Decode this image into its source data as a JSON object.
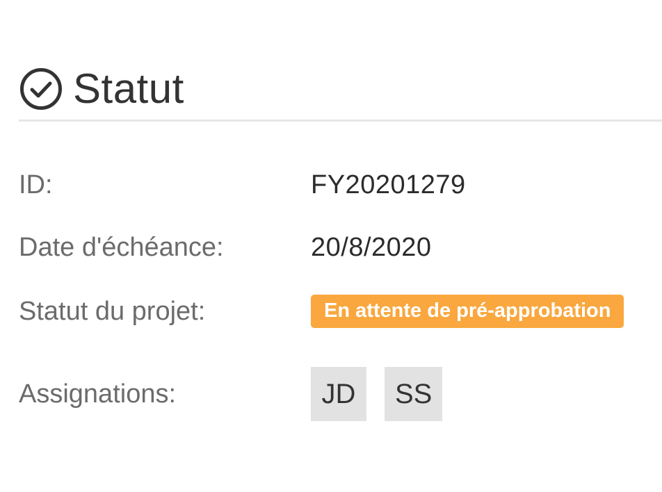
{
  "section": {
    "title": "Statut",
    "icon": "check-circle-icon"
  },
  "fields": {
    "id": {
      "label": "ID:",
      "value": "FY20201279"
    },
    "due_date": {
      "label": "Date d'échéance:",
      "value": "20/8/2020"
    },
    "project_status": {
      "label": "Statut du projet:",
      "badge": "En attente de pré-approbation",
      "badge_color": "#f9a73e"
    },
    "assignments": {
      "label": "Assignations:",
      "assignees": [
        "JD",
        "SS"
      ]
    }
  }
}
